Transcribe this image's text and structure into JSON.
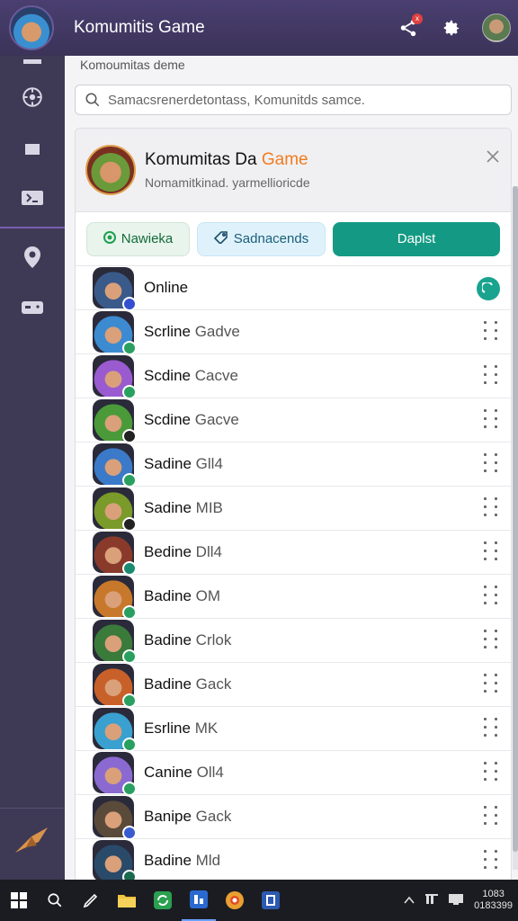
{
  "app": {
    "title": "Komumitis Game",
    "notification_count": "x"
  },
  "breadcrumb": "Komoumitas deme",
  "search": {
    "placeholder": "Samacsrenerdetontass, Komunitds samce."
  },
  "group": {
    "title_main": "Komumitas Da ",
    "title_accent": "Game",
    "subtitle": "Nomamitkinad. yarmellioricde"
  },
  "chips": [
    {
      "label": "Nawieka",
      "icon": "circle-icon"
    },
    {
      "label": "Sadnacends",
      "icon": "tag-icon"
    },
    {
      "label": "Daplst"
    }
  ],
  "members": [
    {
      "first": "Online",
      "rest": "",
      "color": "#3a5a8a",
      "status": "#3450d0"
    },
    {
      "first": "Scrline",
      "rest": "Gadve",
      "color": "#3c8ad0",
      "status": "#2aa060"
    },
    {
      "first": "Scdine",
      "rest": "Cacve",
      "color": "#9a5ad0",
      "status": "#2aa060"
    },
    {
      "first": "Scdine",
      "rest": "Gacve",
      "color": "#4a9a3a",
      "status": "#222222"
    },
    {
      "first": "Sadine",
      "rest": "Gll4",
      "color": "#3a7ac8",
      "status": "#2aa060"
    },
    {
      "first": "Sadine",
      "rest": "MIB",
      "color": "#7a9a2a",
      "status": "#222222"
    },
    {
      "first": "Bedine",
      "rest": "Dll4",
      "color": "#8a3a2a",
      "status": "#1a8a70"
    },
    {
      "first": "Badine",
      "rest": "OM",
      "color": "#c8782a",
      "status": "#2aa060"
    },
    {
      "first": "Badine",
      "rest": "Crlok",
      "color": "#3a7a3a",
      "status": "#2aa060"
    },
    {
      "first": "Badine",
      "rest": "Gack",
      "color": "#c8602a",
      "status": "#2aa060"
    },
    {
      "first": "Esrline",
      "rest": "MK",
      "color": "#3aa0d0",
      "status": "#2aa060"
    },
    {
      "first": "Canine",
      "rest": "Oll4",
      "color": "#8a6ad0",
      "status": "#2aa060"
    },
    {
      "first": "Banipe",
      "rest": "Gack",
      "color": "#5a4a3a",
      "status": "#3a5ad0"
    },
    {
      "first": "Badine",
      "rest": "Mld",
      "color": "#2a4a6a",
      "status": "#1a6a50"
    }
  ],
  "taskbar": {
    "clock_top": "1083",
    "clock_bottom": "0183399"
  }
}
